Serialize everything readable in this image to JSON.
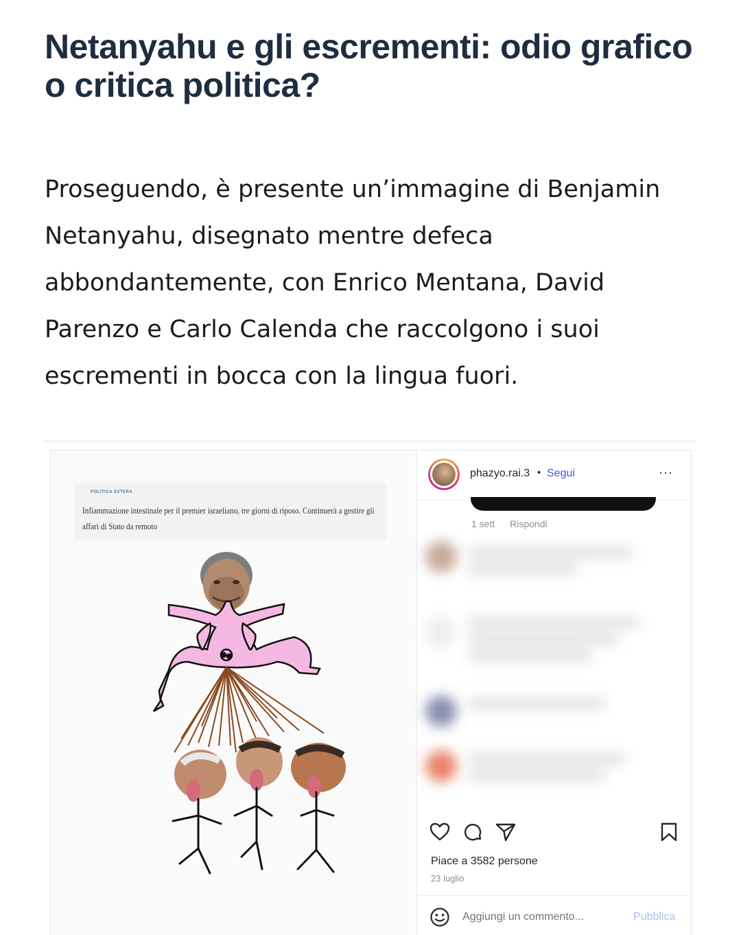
{
  "article": {
    "title": "Netanyahu e gli escrementi: odio grafico o critica politica?",
    "paragraph": "Proseguendo, è presente un’immagine di Benjamin Netanyahu, disegnato mentre defeca abbondantemente, con Enrico Mentana, David Parenzo e Carlo Calenda che raccolgono i suoi escrementi in bocca con la lingua fuori."
  },
  "embed": {
    "news": {
      "tag": "POLITICA ESTERA",
      "headline": "Infiammazione intestinale per il premier israeliano, tre giorni di riposo. Continuerà a gestire gli affari di Stato da remoto"
    },
    "instagram": {
      "username": "phazyo.rai.3",
      "separator": "•",
      "follow_label": "Segui",
      "more_label": "···",
      "comment_age": "1 sett",
      "reply_label": "Rispondi",
      "likes_text": "Piace a 3582 persone",
      "date_text": "23 luglio",
      "comment_placeholder": "Aggiungi un commento...",
      "publish_label": "Pubblica",
      "icons": [
        "heart-icon",
        "comment-icon",
        "share-icon",
        "bookmark-icon",
        "smiley-icon"
      ]
    }
  },
  "colors": {
    "title": "#1f2d40",
    "follow": "#3b5ed6",
    "publish": "#a9bff0"
  }
}
